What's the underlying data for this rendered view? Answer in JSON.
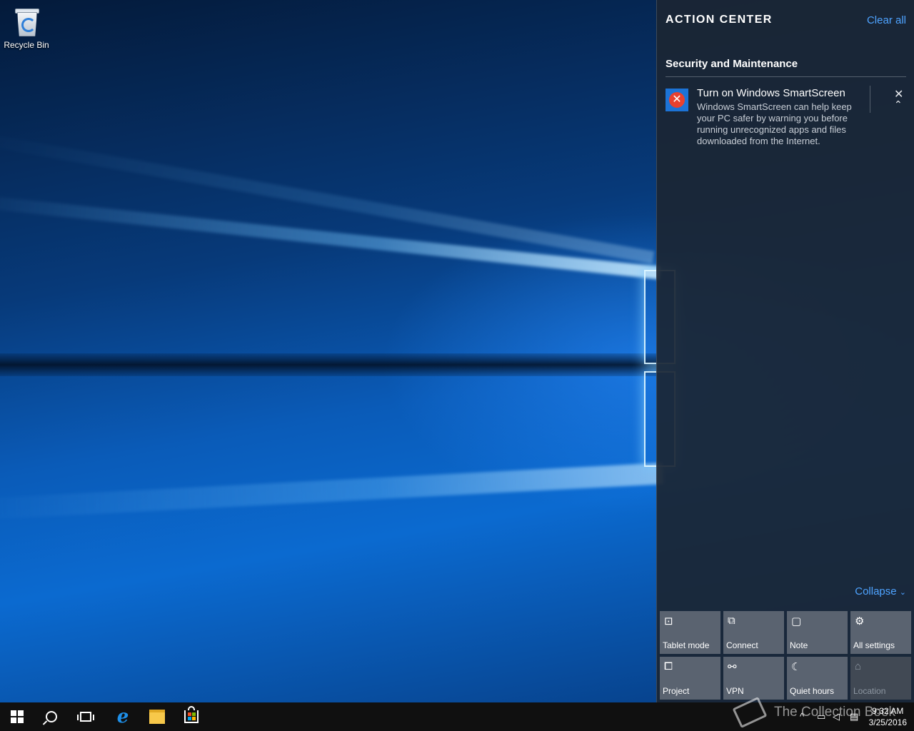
{
  "desktop": {
    "icons": [
      {
        "label": "Recycle Bin",
        "icon": "recycle-bin-icon"
      }
    ]
  },
  "action_center": {
    "title": "ACTION CENTER",
    "clear_all_label": "Clear all",
    "groups": [
      {
        "title": "Security and Maintenance",
        "notifications": [
          {
            "title": "Turn on Windows SmartScreen",
            "body": "Windows SmartScreen can help keep your PC safer by warning you before running unrecognized apps and files downloaded from the Internet.",
            "icon": "error-icon",
            "close_glyph": "✕",
            "collapse_glyph": "⌃"
          }
        ]
      }
    ],
    "collapse_label": "Collapse",
    "quick_actions": [
      {
        "label": "Tablet mode",
        "icon": "tablet-mode-icon",
        "glyph": "⊡",
        "enabled": true
      },
      {
        "label": "Connect",
        "icon": "connect-icon",
        "glyph": "⧉",
        "enabled": true
      },
      {
        "label": "Note",
        "icon": "note-icon",
        "glyph": "▢",
        "enabled": true
      },
      {
        "label": "All settings",
        "icon": "gear-icon",
        "glyph": "⚙",
        "enabled": true
      },
      {
        "label": "Project",
        "icon": "project-icon",
        "glyph": "⧠",
        "enabled": true
      },
      {
        "label": "VPN",
        "icon": "vpn-icon",
        "glyph": "⚯",
        "enabled": true
      },
      {
        "label": "Quiet hours",
        "icon": "moon-icon",
        "glyph": "☾",
        "enabled": true
      },
      {
        "label": "Location",
        "icon": "location-icon",
        "glyph": "⌂",
        "enabled": false
      }
    ]
  },
  "taskbar": {
    "apps": [
      {
        "name": "start",
        "icon": "windows-logo-icon"
      },
      {
        "name": "search",
        "icon": "search-icon"
      },
      {
        "name": "task-view",
        "icon": "task-view-icon"
      },
      {
        "name": "edge",
        "icon": "edge-icon",
        "glyph": "e"
      },
      {
        "name": "file-explorer",
        "icon": "folder-icon"
      },
      {
        "name": "store",
        "icon": "store-icon"
      }
    ],
    "tray": {
      "chevron": "^",
      "network_glyph": "▭",
      "volume_glyph": "◁",
      "notifications_glyph": "▤",
      "time": "9:32 AM",
      "date": "3/25/2016"
    }
  },
  "watermark": {
    "text": "The Collection Book"
  },
  "colors": {
    "accent": "#4ea3ff",
    "panel": "#1b2634",
    "tile": "#5a6370"
  }
}
